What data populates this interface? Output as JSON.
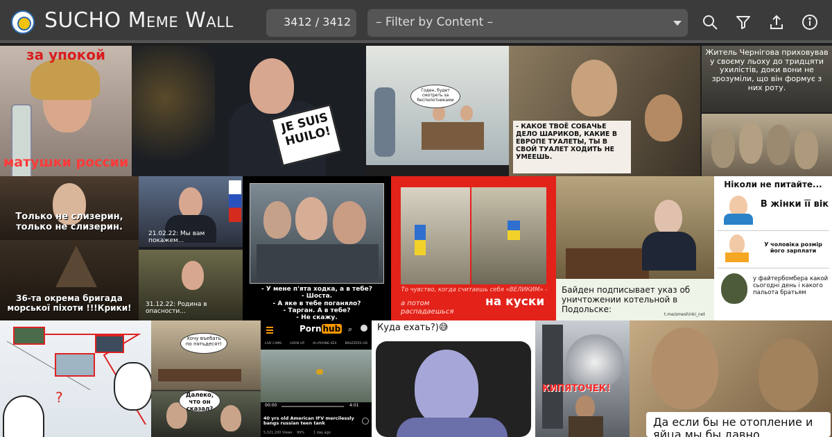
{
  "app": {
    "title": "SUCHO Meme Wall"
  },
  "header": {
    "counter": "3412 / 3412",
    "filter_placeholder": "– Filter by Content –",
    "icons": [
      "search-icon",
      "filter-icon",
      "upload-icon",
      "info-icon"
    ]
  },
  "memes": {
    "m1": {
      "top": "за упокой",
      "bottom": "матушки россии"
    },
    "m2": {
      "sign": "JE SUIS HUILO!"
    },
    "m3": {
      "bubble": "Годен, будет смотреть за беспилотниками"
    },
    "m4": {
      "caption": "- КАКОЕ ТВОЁ СОБАЧЬЕ ДЕЛО ШАРИКОВ, КАКИЕ В ЕВРОПЕ ТУАЛЕТЫ, ТЫ В СВОЙ ТУАЛЕТ ХОДИТЬ НЕ УМЕЕШЬ."
    },
    "m5": {
      "caption": "Житель Чернігова приховував у своєму льоху до тридцяти ухилістів, доки вони не зрозуміли, що він формує з них роту."
    },
    "m7": {
      "top": "Только не слизерин, только не слизерин.",
      "bottom": "36-та окрема бригада морської піхоти !!!Крики!"
    },
    "m8": {
      "top": "21.02.22: Мы вам покажем...",
      "bottom": "31.12.22: Родина в опасности..."
    },
    "m9": {
      "dialogue": "- У мене п'ята ходка, а в тебе?\n- Шоста.\n- А яке в тебе поганяло?\n- Тарган. А в тебе?\n- Не скажу."
    },
    "m10": {
      "line1": "То чувство, когда считаешь себя «ВЕЛИКИМ» -",
      "line2": "а потом распадаешься",
      "big": "на куски"
    },
    "m11": {
      "caption": "Байден подписывает указ об уничтожении котельной в Подольске:",
      "handle": "t.me/smeshinki_net"
    },
    "m12": {
      "title": "Ніколи не питайте...",
      "row1": "В жінки її вік",
      "row2": "У чоловіка розмір його зарплати",
      "row3": "у файтербомбера какой сьогодні день і какого пальота братьям"
    },
    "m14": {
      "top": "Хочу въебать по пятьдесят!",
      "bottom": "Далеко, что он сказал?"
    },
    "m15": {
      "logo_a": "Porn",
      "logo_b": "hub",
      "tabs": [
        "LIVE CAMS",
        "HOOK UP",
        "AI+PHONE-SEX",
        "BRAZZERS HD"
      ],
      "time_left": "00:00",
      "time_right": "4:01",
      "title": "40 yrs old American IFV mercilessly bangs russian teen tank",
      "views": "5,021,200 Views",
      "rating": "99%",
      "age": "1 day ago"
    },
    "m16": {
      "top": "Куда ехать?)😅"
    },
    "m17": {
      "caption": "КИПЯТОЧЕК!"
    },
    "m18": {
      "caption": "Да если бы не отопление и яйца мы бы давно..."
    }
  },
  "colors": {
    "header_bg": "#3b3b3b",
    "control_bg": "#555555",
    "red": "#e02020"
  }
}
